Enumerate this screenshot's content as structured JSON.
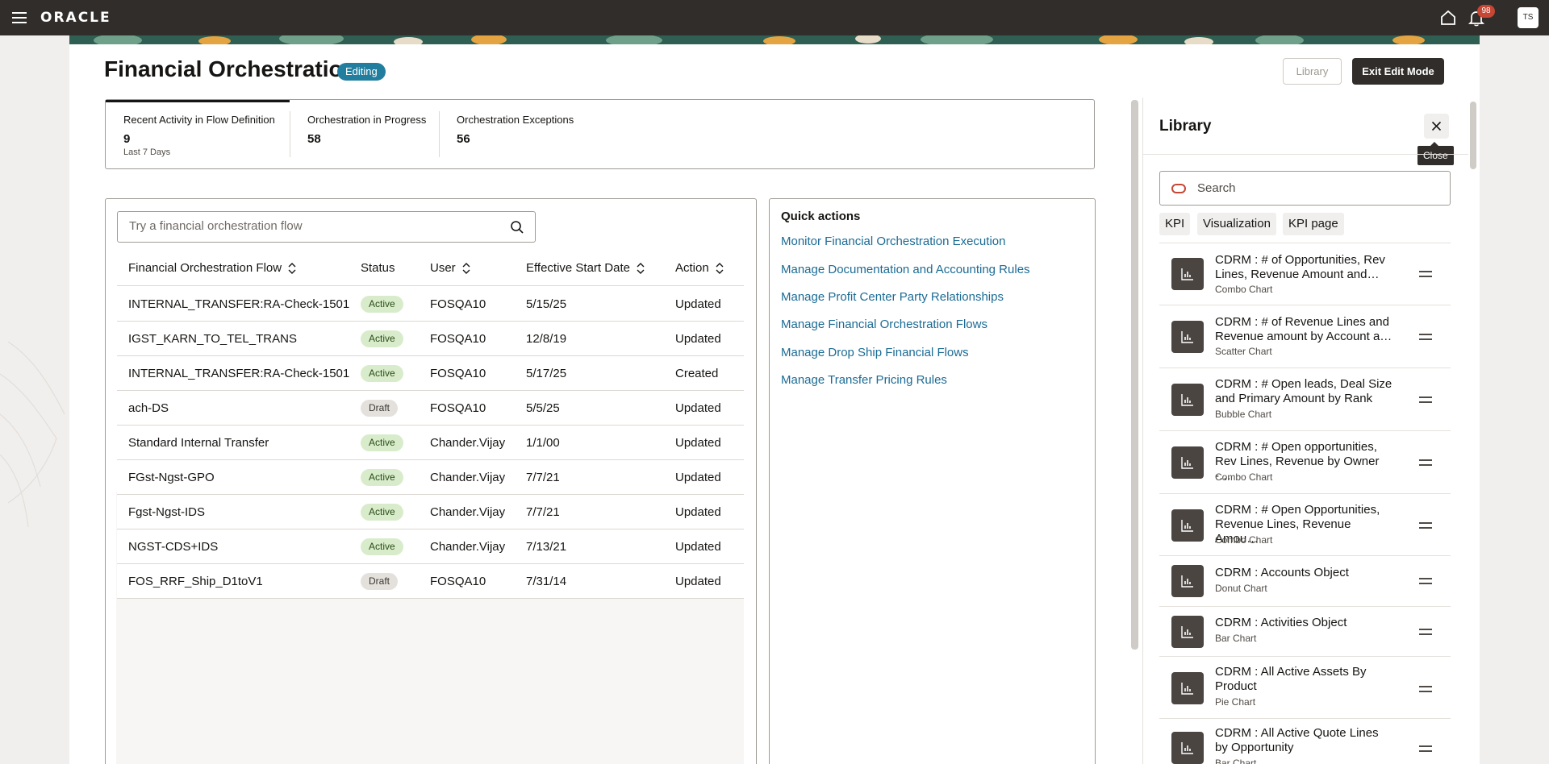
{
  "header": {
    "brand": "ORACLE",
    "notification_count": "98",
    "user_initials": "TS"
  },
  "page": {
    "title": "Financial Orchestration",
    "mode_badge": "Editing",
    "library_button": "Library",
    "exit_button": "Exit Edit Mode"
  },
  "metrics": [
    {
      "label": "Recent Activity in Flow Definition",
      "value": "9",
      "sub": "Last 7 Days"
    },
    {
      "label": "Orchestration in Progress",
      "value": "58",
      "sub": ""
    },
    {
      "label": "Orchestration Exceptions",
      "value": "56",
      "sub": ""
    }
  ],
  "flows": {
    "search_placeholder": "Try a financial orchestration flow",
    "columns": [
      "Financial Orchestration Flow",
      "Status",
      "User",
      "Effective Start Date",
      "Action"
    ],
    "rows": [
      {
        "flow": "INTERNAL_TRANSFER:RA-Check-1501",
        "status": "Active",
        "user": "FOSQA10",
        "date": "5/15/25",
        "action": "Updated"
      },
      {
        "flow": "IGST_KARN_TO_TEL_TRANS",
        "status": "Active",
        "user": "FOSQA10",
        "date": "12/8/19",
        "action": "Updated"
      },
      {
        "flow": "INTERNAL_TRANSFER:RA-Check-1501",
        "status": "Active",
        "user": "FOSQA10",
        "date": "5/17/25",
        "action": "Created"
      },
      {
        "flow": "ach-DS",
        "status": "Draft",
        "user": "FOSQA10",
        "date": "5/5/25",
        "action": "Updated"
      },
      {
        "flow": "Standard Internal Transfer",
        "status": "Active",
        "user": "Chander.Vijay",
        "date": "1/1/00",
        "action": "Updated"
      },
      {
        "flow": "FGst-Ngst-GPO",
        "status": "Active",
        "user": "Chander.Vijay",
        "date": "7/7/21",
        "action": "Updated"
      },
      {
        "flow": "Fgst-Ngst-IDS",
        "status": "Active",
        "user": "Chander.Vijay",
        "date": "7/7/21",
        "action": "Updated"
      },
      {
        "flow": "NGST-CDS+IDS",
        "status": "Active",
        "user": "Chander.Vijay",
        "date": "7/13/21",
        "action": "Updated"
      },
      {
        "flow": "FOS_RRF_Ship_D1toV1",
        "status": "Draft",
        "user": "FOSQA10",
        "date": "7/31/14",
        "action": "Updated"
      }
    ]
  },
  "quick_actions": {
    "title": "Quick actions",
    "links": [
      "Monitor Financial Orchestration Execution",
      "Manage Documentation and Accounting Rules",
      "Manage Profit Center Party Relationships",
      "Manage Financial Orchestration Flows",
      "Manage Drop Ship Financial Flows",
      "Manage Transfer Pricing Rules"
    ]
  },
  "library": {
    "title": "Library",
    "close_tooltip": "Close",
    "search_placeholder": "Search",
    "filters": [
      "KPI",
      "Visualization",
      "KPI page"
    ],
    "items": [
      {
        "name": "CDRM : # of Opportunities, Rev Lines, Revenue Amount and…",
        "type": "Combo Chart"
      },
      {
        "name": "CDRM : # of Revenue Lines and Revenue amount by Account a…",
        "type": "Scatter Chart"
      },
      {
        "name": "CDRM : # Open leads, Deal Size and Primary Amount by Rank",
        "type": "Bubble Chart"
      },
      {
        "name": "CDRM : # Open opportunities, Rev Lines, Revenue by Owner -…",
        "type": "Combo Chart"
      },
      {
        "name": "CDRM : # Open Opportunities, Revenue Lines, Revenue Amou…",
        "type": "Combo Chart"
      },
      {
        "name": "CDRM : Accounts Object",
        "type": "Donut Chart"
      },
      {
        "name": "CDRM : Activities Object",
        "type": "Bar Chart"
      },
      {
        "name": "CDRM : All Active Assets By Product",
        "type": "Pie Chart"
      },
      {
        "name": "CDRM : All Active Quote Lines by Opportunity",
        "type": "Bar Chart"
      }
    ]
  }
}
